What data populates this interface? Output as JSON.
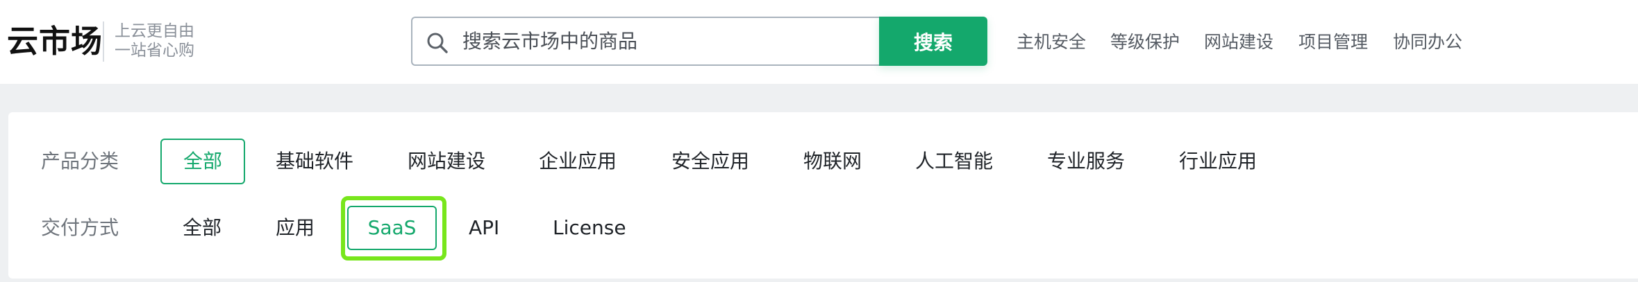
{
  "brand": {
    "title": "云市场",
    "slogan_line1": "上云更自由",
    "slogan_line2": "一站省心购"
  },
  "search": {
    "placeholder": "搜索云市场中的商品",
    "button_label": "搜索",
    "accent_color": "#14a86c"
  },
  "hot_links": [
    "主机安全",
    "等级保护",
    "网站建设",
    "项目管理",
    "协同办公"
  ],
  "filters": {
    "category": {
      "label": "产品分类",
      "selected": "全部",
      "options": [
        "全部",
        "基础软件",
        "网站建设",
        "企业应用",
        "安全应用",
        "物联网",
        "人工智能",
        "专业服务",
        "行业应用"
      ]
    },
    "delivery": {
      "label": "交付方式",
      "selected": "SaaS",
      "options": [
        "全部",
        "应用",
        "SaaS",
        "API",
        "License"
      ]
    }
  },
  "icons": {
    "search": "search-icon"
  },
  "highlight_color": "#78e61c"
}
